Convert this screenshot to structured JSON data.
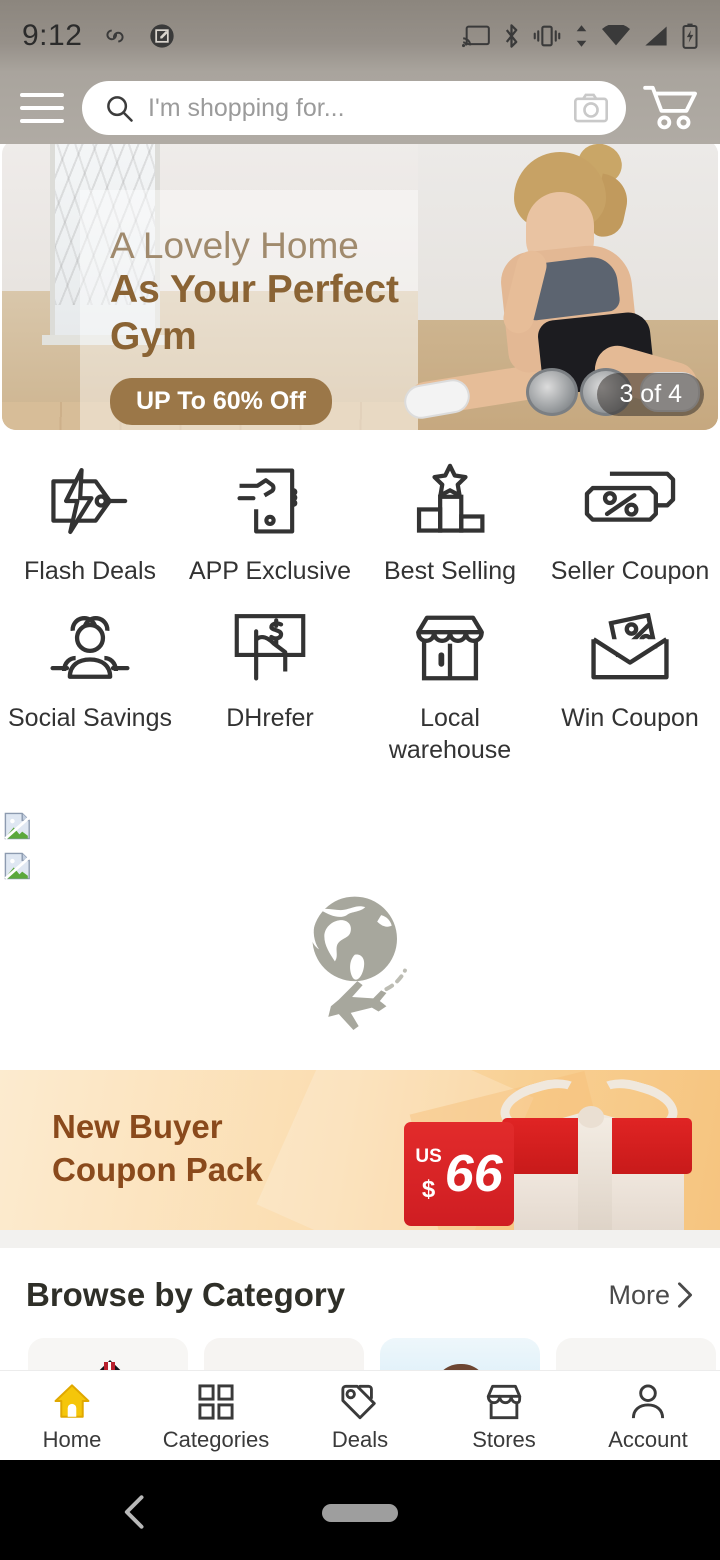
{
  "status_bar": {
    "time": "9:12",
    "left_icons": [
      "link-icon",
      "screenshot-edit-icon"
    ],
    "right_icons": [
      "cast-icon",
      "bluetooth-icon",
      "vibrate-icon",
      "data-transfer-icon",
      "wifi-icon",
      "cellular-signal-icon",
      "battery-charging-icon"
    ]
  },
  "header": {
    "menu_icon": "hamburger-menu-icon",
    "search_placeholder": "I'm shopping for...",
    "search_value": "",
    "search_icon": "search-icon",
    "camera_icon": "camera-icon",
    "cart_icon": "shopping-cart-icon"
  },
  "hero": {
    "line1": "A Lovely Home",
    "line2a": "As Your Perfect",
    "line2b": "Gym",
    "badge": "UP To 60% Off",
    "counter": "3 of 4",
    "accent_color": "#8a6334",
    "badge_color": "#9b7748"
  },
  "quick_links": [
    {
      "label": "Flash Deals",
      "icon": "flash-deals-icon"
    },
    {
      "label": "APP Exclusive",
      "icon": "app-exclusive-icon"
    },
    {
      "label": "Best Selling",
      "icon": "best-selling-icon"
    },
    {
      "label": "Seller Coupon",
      "icon": "seller-coupon-icon"
    },
    {
      "label": "Social Savings",
      "icon": "social-savings-icon"
    },
    {
      "label": "DHrefer",
      "icon": "dhrefer-icon"
    },
    {
      "label": "Local warehouse",
      "icon": "local-warehouse-icon"
    },
    {
      "label": "Win Coupon",
      "icon": "win-coupon-icon"
    }
  ],
  "placeholders": {
    "broken_images": 2,
    "loading_graphic": "globe-airplane-icon"
  },
  "coupon_banner": {
    "line1": "New Buyer",
    "line2": "Coupon Pack",
    "currency": "US",
    "dollar_sign": "$",
    "amount": "66",
    "text_color": "#8a4a1c",
    "tag_color": "#d92027"
  },
  "category_section": {
    "title": "Browse by Category",
    "more_label": "More",
    "more_icon": "chevron-right-icon",
    "cards": 4
  },
  "tab_bar": {
    "active": "Home",
    "active_color": "#f5c60a",
    "items": [
      {
        "label": "Home",
        "icon": "home-icon"
      },
      {
        "label": "Categories",
        "icon": "grid-icon"
      },
      {
        "label": "Deals",
        "icon": "tag-icon"
      },
      {
        "label": "Stores",
        "icon": "store-icon"
      },
      {
        "label": "Account",
        "icon": "person-icon"
      }
    ]
  },
  "android_nav": {
    "back_icon": "back-chevron-icon",
    "home_pill": "gesture-pill"
  }
}
